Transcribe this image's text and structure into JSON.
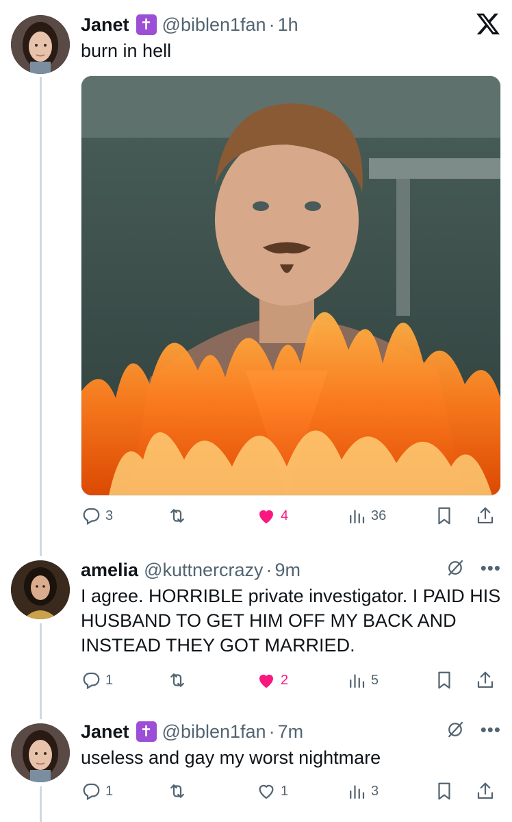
{
  "tweets": [
    {
      "name": "Janet",
      "badge": "✝",
      "handle": "@biblen1fan",
      "time": "1h",
      "text": "burn in hell",
      "actions": {
        "replies": "3",
        "retweets": "",
        "likes": "4",
        "views": "36"
      },
      "liked": true
    },
    {
      "name": "amelia",
      "handle": "@kuttnercrazy",
      "time": "9m",
      "text": "I agree. HORRIBLE private investigator. I PAID HIS HUSBAND TO GET HIM OFF MY BACK AND INSTEAD THEY GOT MARRIED.",
      "actions": {
        "replies": "1",
        "retweets": "",
        "likes": "2",
        "views": "5"
      },
      "liked": true
    },
    {
      "name": "Janet",
      "badge": "✝",
      "handle": "@biblen1fan",
      "time": "7m",
      "text": "useless and gay my worst nightmare",
      "actions": {
        "replies": "1",
        "retweets": "",
        "likes": "1",
        "views": "3"
      },
      "liked": false
    }
  ],
  "icons": {
    "brand": "x-logo-icon",
    "reply": "reply-icon",
    "retweet": "retweet-icon",
    "like": "heart-icon",
    "views": "views-chart-icon",
    "bookmark": "bookmark-icon",
    "share": "share-icon",
    "grok": "grok-icon",
    "more": "more-icon"
  },
  "colors": {
    "text": "#0f1419",
    "muted": "#536471",
    "like": "#f91880",
    "badge": "#9c4fd6",
    "thread_line": "#cfd9de"
  }
}
